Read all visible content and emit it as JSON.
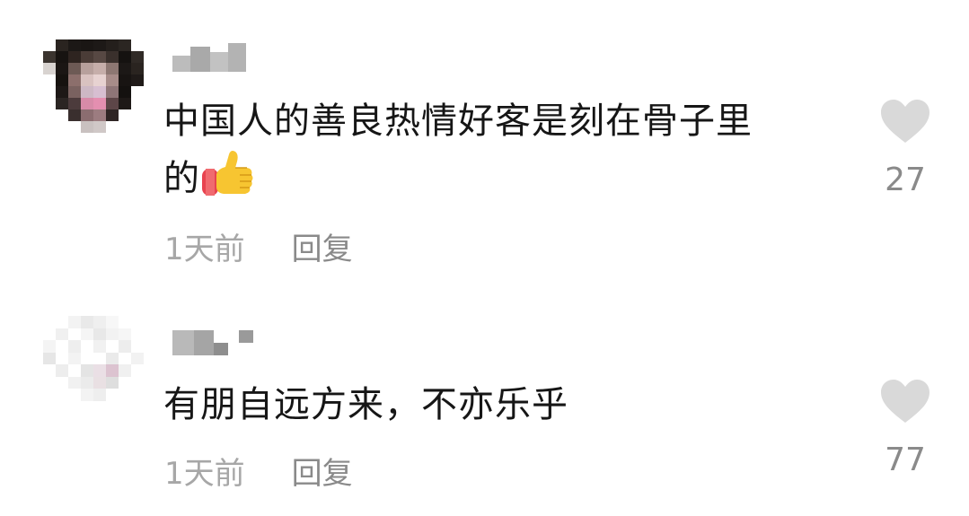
{
  "comments": [
    {
      "text_line1": "中国人的善良热情好客是刻在骨子里",
      "text_line2": "的",
      "emoji": "thumbs-up",
      "time": "1天前",
      "reply": "回复",
      "likes": "27"
    },
    {
      "text_line1": "有朋自远方来，不亦乐乎",
      "time": "1天前",
      "reply": "回复",
      "likes": "77"
    }
  ],
  "colors": {
    "text": "#161616",
    "meta": "#a7a7a7",
    "heart": "#d9d9d9",
    "count": "#8a8a8a"
  }
}
